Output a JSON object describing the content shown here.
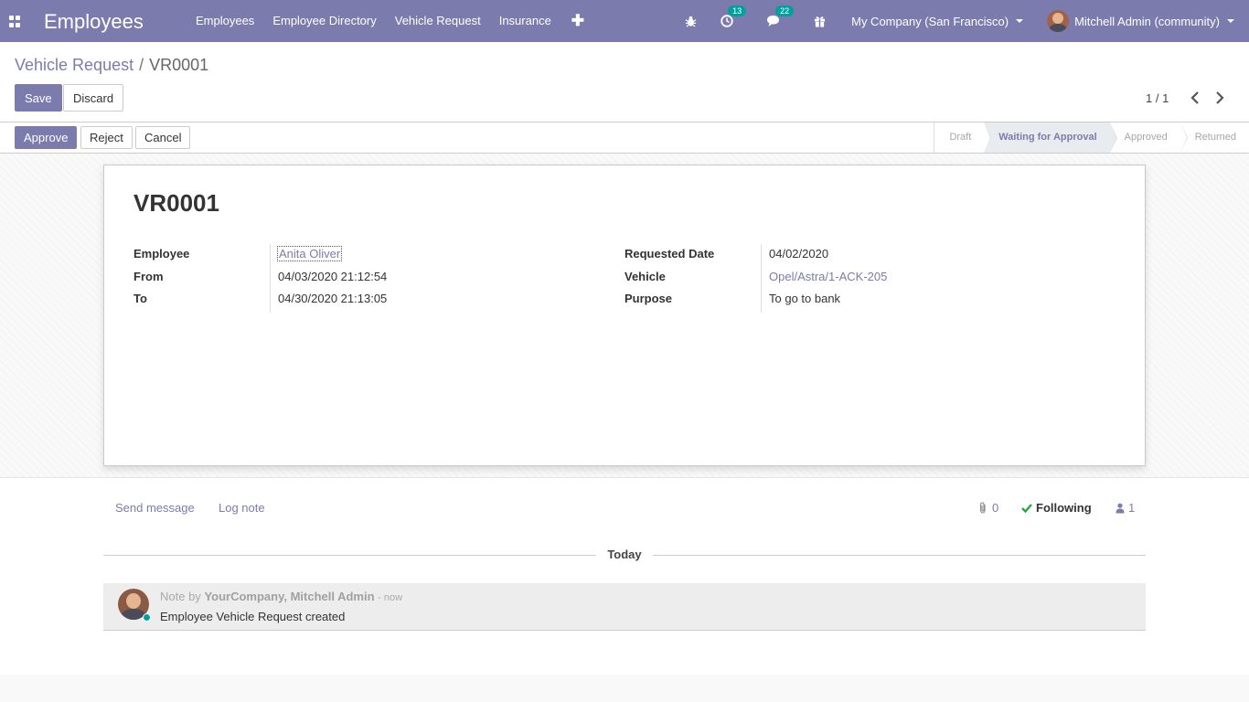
{
  "navbar": {
    "app_title": "Employees",
    "menu": [
      "Employees",
      "Employee Directory",
      "Vehicle Request",
      "Insurance"
    ],
    "plus_label": "✚",
    "activity_count": "13",
    "message_count": "22",
    "company": "My Company (San Francisco)",
    "user": "Mitchell Admin (community)"
  },
  "breadcrumb": {
    "parent": "Vehicle Request",
    "separator": "/",
    "current": "VR0001"
  },
  "buttons": {
    "save": "Save",
    "discard": "Discard"
  },
  "pager": {
    "value": "1 / 1"
  },
  "status_buttons": {
    "approve": "Approve",
    "reject": "Reject",
    "cancel": "Cancel"
  },
  "stages": [
    "Draft",
    "Waiting for Approval",
    "Approved",
    "Returned"
  ],
  "active_stage": "Waiting for Approval",
  "record": {
    "name": "VR0001",
    "employee_label": "Employee",
    "employee": "Anita Oliver",
    "from_label": "From",
    "from": "04/03/2020 21:12:54",
    "to_label": "To",
    "to": "04/30/2020 21:13:05",
    "requested_date_label": "Requested Date",
    "requested_date": "04/02/2020",
    "vehicle_label": "Vehicle",
    "vehicle": "Opel/Astra/1-ACK-205",
    "purpose_label": "Purpose",
    "purpose": "To go to bank"
  },
  "chatter": {
    "send_message": "Send message",
    "log_note": "Log note",
    "attachments": "0",
    "following": "Following",
    "followers": "1",
    "today": "Today",
    "note_prefix": "Note by",
    "note_author": "YourCompany, Mitchell Admin",
    "note_time": "- now",
    "note_body": "Employee Vehicle Request created"
  },
  "colors": {
    "brand": "#7c7bad",
    "badge": "#00a09d",
    "following_check": "#28a745"
  }
}
